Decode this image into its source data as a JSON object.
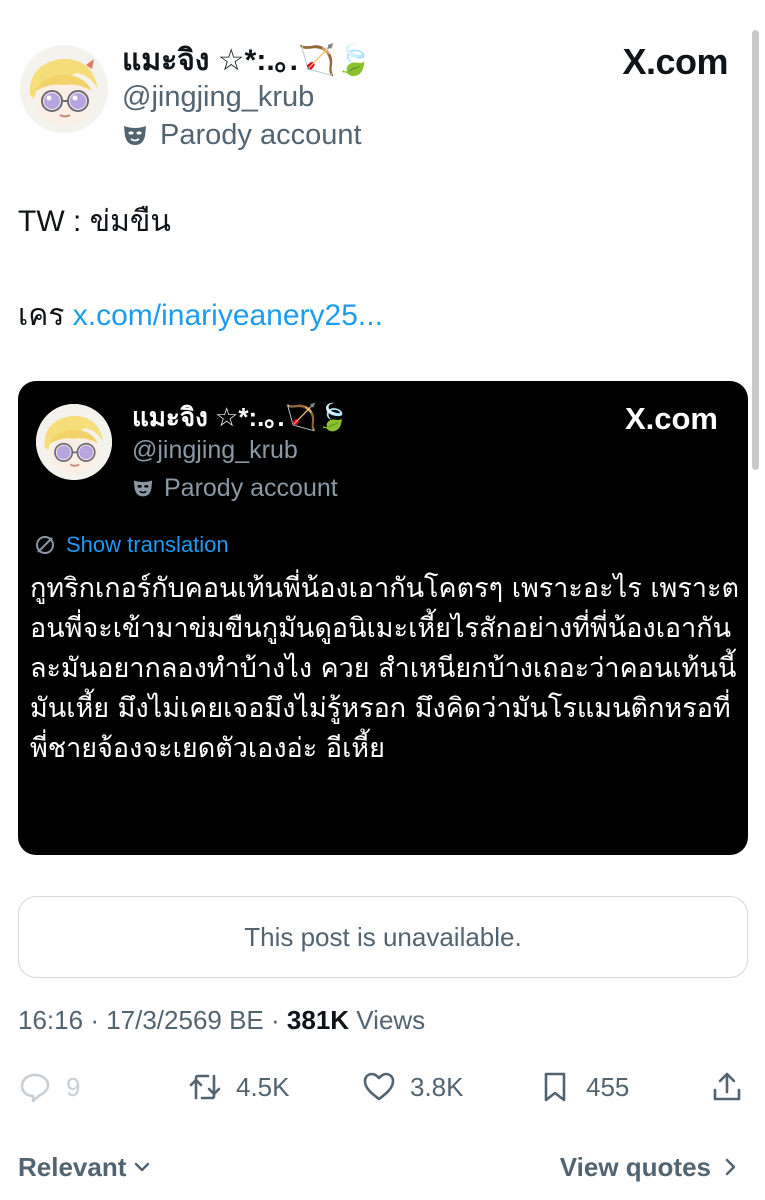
{
  "header": {
    "display_name": "แมะจิง ☆*:.｡.🏹🍃",
    "handle": "@jingjing_krub",
    "parody_label": "Parody account",
    "logo_text": "X.com"
  },
  "post": {
    "tw_line": "TW : ข่มขืน",
    "credit_prefix": "เคร",
    "credit_link": "x.com/inariyeanery25..."
  },
  "embedded_card": {
    "display_name": "แมะจิง ☆*:.｡.🏹🍃",
    "handle": "@jingjing_krub",
    "parody_label": "Parody account",
    "logo_text": "X.com",
    "translation_label": "Show translation",
    "text": "กูทริกเกอร์กับคอนเท้นพี่น้องเอากันโคตรๆ เพราะอะไร เพราะตอนพี่จะเข้ามาข่มขืนกูมันดูอนิเมะเหี้ยไรสักอย่างที่พี่น้องเอากันละมันอยากลองทำบ้างไง ควย สำเหนียกบ้างเถอะว่าคอนเท้นนี้มันเหี้ย มึงไม่เคยเจอมึงไม่รู้หรอก มึงคิดว่ามันโรแมนติกหรอที่พี่ชายจ้องจะเยดตัวเองอ่ะ อีเหี้ย"
  },
  "unavailable": {
    "text": "This post is unavailable."
  },
  "meta": {
    "time": "16:16",
    "date": "17/3/2569 BE",
    "views_count": "381K",
    "views_label": "Views"
  },
  "actions": {
    "replies": "9",
    "reposts": "4.5K",
    "likes": "3.8K",
    "bookmarks": "455"
  },
  "footer": {
    "sort_label": "Relevant",
    "view_quotes_label": "View quotes"
  }
}
